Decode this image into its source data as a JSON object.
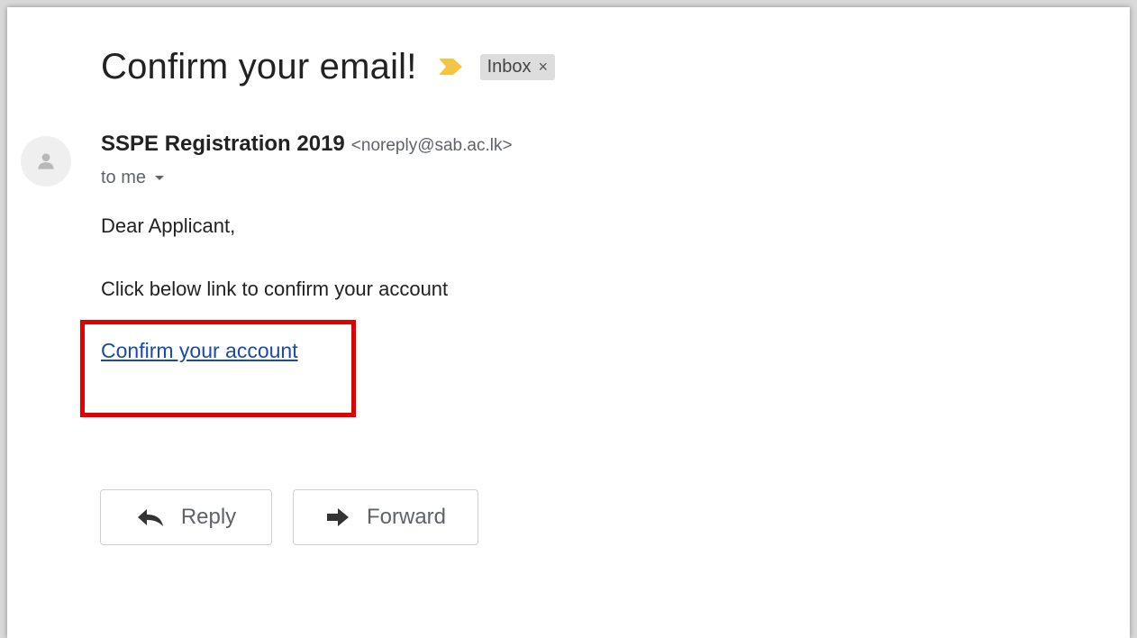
{
  "email": {
    "subject": "Confirm your email!",
    "label": "Inbox",
    "label_close": "×",
    "sender_name": "SSPE Registration 2019",
    "sender_email": "<noreply@sab.ac.lk>",
    "recipient": "to me",
    "greeting": "Dear Applicant,",
    "instruction": "Click below link to confirm your account",
    "confirm_link": "Confirm your account"
  },
  "actions": {
    "reply_label": "Reply",
    "forward_label": "Forward"
  },
  "colors": {
    "link": "#1a4ba8",
    "highlight": "#e00000",
    "importance_marker": "#f4c542"
  },
  "icons": {
    "importance": "importance-marker-icon",
    "avatar": "person-icon",
    "reply": "reply-arrow-icon",
    "forward": "forward-arrow-icon",
    "recipient_details": "caret-down-icon"
  }
}
